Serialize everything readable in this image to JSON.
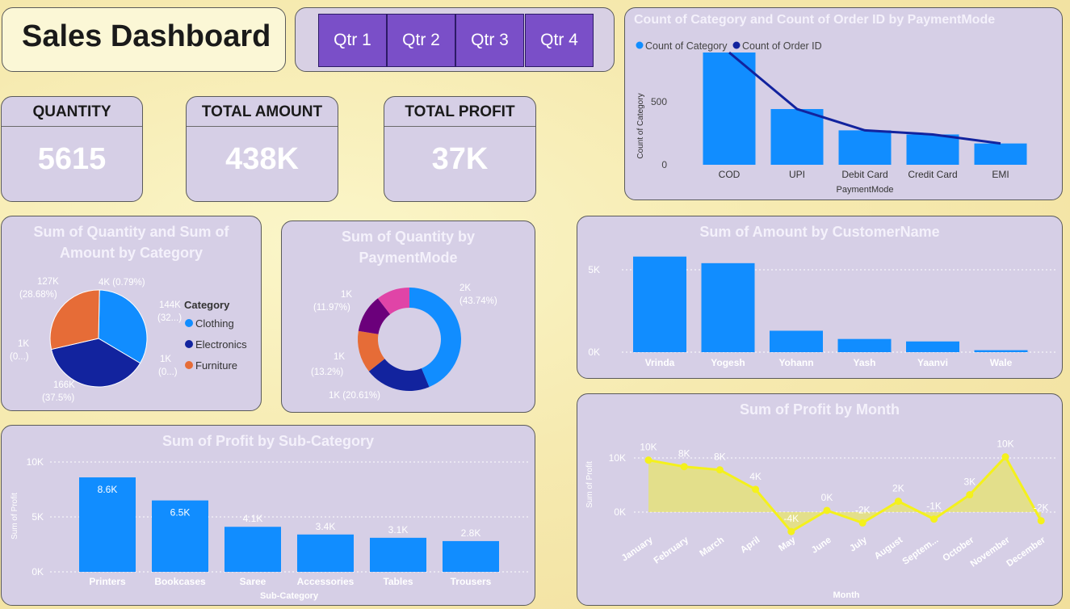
{
  "header": {
    "title": "Sales Dashboard"
  },
  "quarters": [
    "Qtr 1",
    "Qtr 2",
    "Qtr 3",
    "Qtr 4"
  ],
  "kpis": {
    "quantity": {
      "label": "QUANTITY",
      "value": "5615"
    },
    "amount": {
      "label": "TOTAL AMOUNT",
      "value": "438K"
    },
    "profit": {
      "label": "TOTAL PROFIT",
      "value": "37K"
    }
  },
  "colors": {
    "blue": "#118dff",
    "navy": "#12239e",
    "orange": "#e66c37",
    "purple": "#6b007b",
    "pink": "#e044a7",
    "yellow": "#f4f11c"
  },
  "charts": {
    "payment_combo": {
      "title": "Count of Category and Count of Order ID by PaymentMode",
      "legend": [
        "Count of Category",
        "Count of Order ID"
      ],
      "xlabel": "PaymentMode",
      "ylabel": "Count of Category",
      "yticks": [
        "500",
        "0"
      ]
    },
    "category_pie": {
      "title_l1": "Sum of Quantity and Sum of",
      "title_l2": "Amount by Category",
      "legend_title": "Category",
      "labels": [
        "4K (0.79%)",
        "144K",
        "(32...)",
        "1K",
        "(0...)",
        "166K",
        "(37.5%)",
        "1K",
        "(0...)",
        "127K",
        "(28.68%)"
      ]
    },
    "quantity_donut": {
      "title_l1": "Sum of Quantity by",
      "title_l2": "PaymentMode",
      "labels": [
        "2K",
        "(43.74%)",
        "1K (20.61%)",
        "1K",
        "(13.2%)",
        "1K",
        "(11.97%)"
      ]
    },
    "customer_bar": {
      "title": "Sum of Amount by CustomerName",
      "yticks": [
        "5K",
        "0K"
      ]
    },
    "subcat_bar": {
      "title": "Sum of Profit by Sub-Category",
      "xlabel": "Sub-Category",
      "ylabel": "Sum of Profit",
      "yticks": [
        "10K",
        "5K",
        "0K"
      ]
    },
    "month_line": {
      "title": "Sum of Profit by Month",
      "xlabel": "Month",
      "ylabel": "Sum of Profit",
      "yticks": [
        "10K",
        "0K"
      ]
    }
  },
  "chart_data": [
    {
      "type": "bar",
      "title": "Count of Category and Count of Order ID by PaymentMode",
      "categories": [
        "COD",
        "UPI",
        "Debit Card",
        "Credit Card",
        "EMI"
      ],
      "series": [
        {
          "name": "Count of Category",
          "values": [
            685,
            340,
            210,
            185,
            130
          ]
        },
        {
          "name": "Count of Order ID",
          "values": [
            685,
            340,
            210,
            185,
            130
          ]
        }
      ],
      "xlabel": "PaymentMode",
      "ylabel": "Count of Category",
      "ylim": [
        0,
        700
      ]
    },
    {
      "type": "pie",
      "title": "Sum of Quantity and Sum of Amount by Category",
      "categories": [
        "Clothing",
        "Electronics",
        "Furniture"
      ],
      "values": [
        32.9,
        37.5,
        28.68
      ]
    },
    {
      "type": "pie",
      "title": "Sum of Quantity by PaymentMode",
      "categories": [
        "COD",
        "UPI",
        "Debit Card",
        "Credit Card",
        "EMI"
      ],
      "values": [
        43.74,
        20.61,
        13.2,
        11.97,
        10.48
      ]
    },
    {
      "type": "bar",
      "title": "Sum of Amount by CustomerName",
      "categories": [
        "Vrinda",
        "Yogesh",
        "Yohann",
        "Yash",
        "Yaanvi",
        "Wale"
      ],
      "values": [
        5800,
        5400,
        1300,
        800,
        650,
        120
      ],
      "ylim": [
        0,
        6500
      ]
    },
    {
      "type": "bar",
      "title": "Sum of Profit by Sub-Category",
      "categories": [
        "Printers",
        "Bookcases",
        "Saree",
        "Accessories",
        "Tables",
        "Trousers"
      ],
      "values": [
        8.6,
        6.5,
        4.1,
        3.4,
        3.1,
        2.8
      ],
      "data_labels": [
        "8.6K",
        "6.5K",
        "4.1K",
        "3.4K",
        "3.1K",
        "2.8K"
      ],
      "xlabel": "Sub-Category",
      "ylabel": "Sum of Profit",
      "ylim": [
        0,
        10
      ]
    },
    {
      "type": "area",
      "title": "Sum of Profit by Month",
      "categories": [
        "January",
        "February",
        "March",
        "April",
        "May",
        "June",
        "July",
        "August",
        "Septem...",
        "October",
        "November",
        "December"
      ],
      "values": [
        9.6,
        8.4,
        7.8,
        4.2,
        -3.6,
        0.3,
        -2.0,
        2.0,
        -1.3,
        3.2,
        10.2,
        -1.6
      ],
      "data_labels": [
        "10K",
        "8K",
        "8K",
        "4K",
        "-4K",
        "0K",
        "-2K",
        "2K",
        "-1K",
        "3K",
        "10K",
        "-2K"
      ],
      "xlabel": "Month",
      "ylabel": "Sum of Profit",
      "ylim": [
        -6,
        12
      ]
    }
  ]
}
